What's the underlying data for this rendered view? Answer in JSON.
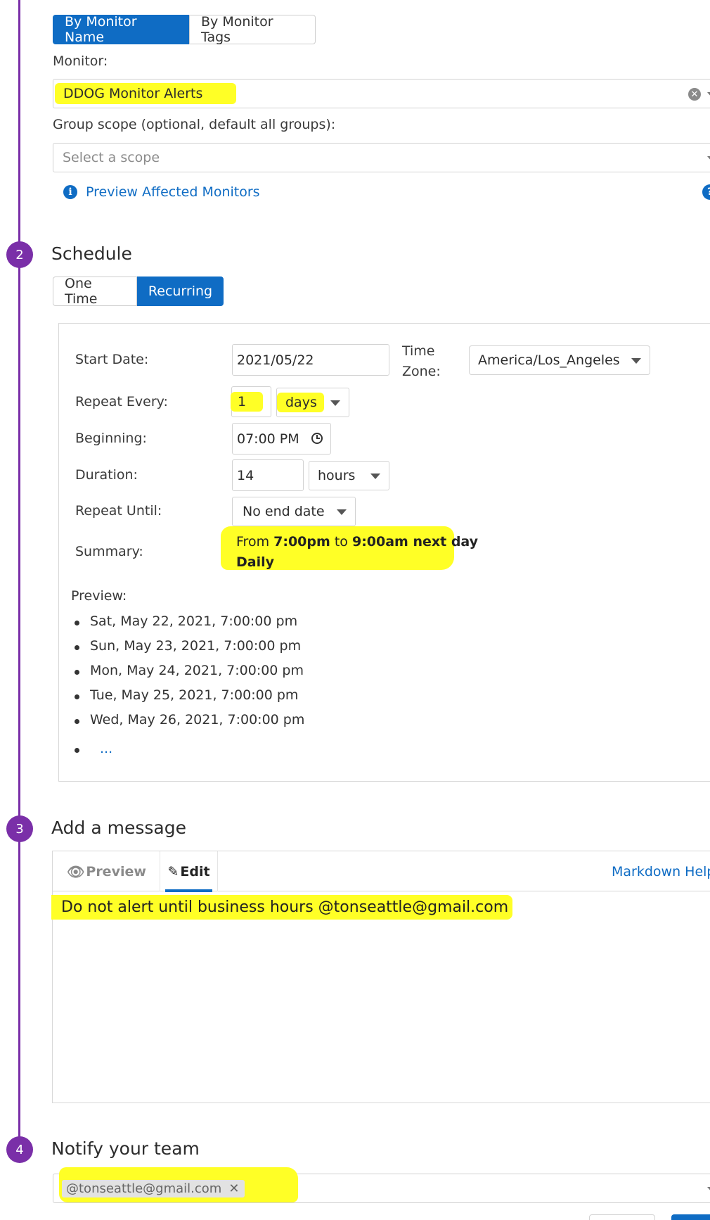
{
  "monitor_section": {
    "mode_tabs": [
      "By Monitor Name",
      "By Monitor Tags"
    ],
    "active_mode": "By Monitor Name",
    "monitor_label": "Monitor:",
    "monitor_value": "DDOG Monitor Alerts",
    "group_scope_label": "Group scope (optional, default all groups):",
    "group_scope_placeholder": "Select a scope",
    "preview_link": "Preview Affected Monitors"
  },
  "steps": {
    "s2": {
      "num": "2",
      "title": "Schedule"
    },
    "s3": {
      "num": "3",
      "title": "Add a message"
    },
    "s4": {
      "num": "4",
      "title": "Notify your team"
    }
  },
  "schedule": {
    "type_tabs": [
      "One Time",
      "Recurring"
    ],
    "active_type": "Recurring",
    "start_date_label": "Start Date:",
    "start_date": "2021/05/22",
    "time_zone_label_1": "Time",
    "time_zone_label_2": "Zone:",
    "time_zone": "America/Los_Angeles",
    "repeat_every_label": "Repeat Every:",
    "repeat_every_value": "1",
    "repeat_every_unit": "days",
    "beginning_label": "Beginning:",
    "beginning_value": "07:00 PM",
    "duration_label": "Duration:",
    "duration_value": "14",
    "duration_unit": "hours",
    "repeat_until_label": "Repeat Until:",
    "repeat_until_value": "No end date",
    "summary_label": "Summary:",
    "summary": {
      "from": "From",
      "start": "7:00pm",
      "to": "to",
      "end": "9:00am next day",
      "frequency": "Daily"
    },
    "preview_label": "Preview:",
    "preview_items": [
      "Sat, May 22, 2021, 7:00:00 pm",
      "Sun, May 23, 2021, 7:00:00 pm",
      "Mon, May 24, 2021, 7:00:00 pm",
      "Tue, May 25, 2021, 7:00:00 pm",
      "Wed, May 26, 2021, 7:00:00 pm"
    ],
    "preview_more": "..."
  },
  "message": {
    "tab_preview": "Preview",
    "tab_edit": "Edit",
    "markdown_help": "Markdown Help",
    "text": "Do not alert until business hours @tonseattle@gmail.com"
  },
  "notify": {
    "recipient": "@tonseattle@gmail.com"
  },
  "colors": {
    "accent_blue": "#0f6cc4",
    "step_purple": "#7a2fa8",
    "highlight": "#ffff26"
  }
}
